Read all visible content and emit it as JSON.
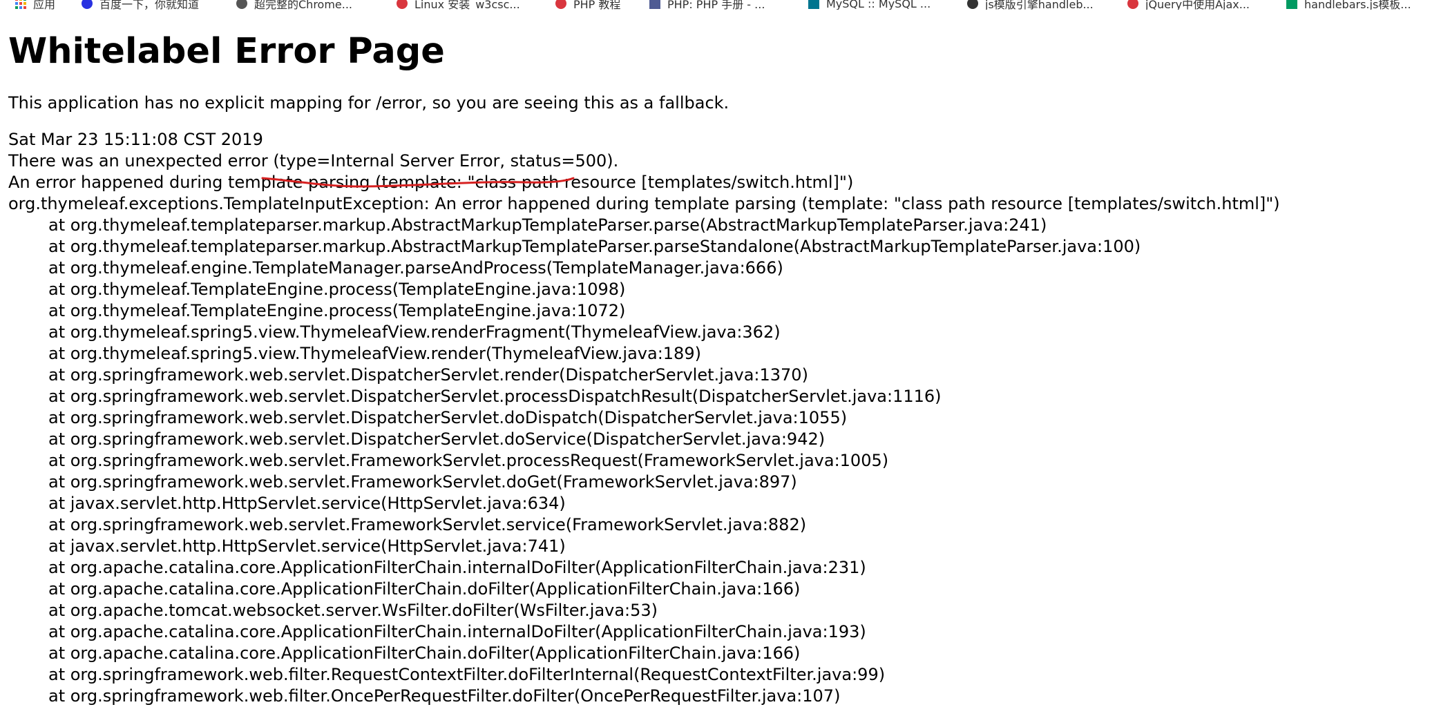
{
  "bookmarks": [
    {
      "label": "应用",
      "icon": "apps-grid-icon",
      "color": "#e8453c"
    },
    {
      "label": "百度一下，你就知道",
      "icon": "baidu-paw-icon",
      "color": "#2932e1"
    },
    {
      "label": "超完整的Chrome...",
      "icon": "leaf-icon",
      "color": "#555555"
    },
    {
      "label": "Linux 安装_w3csc...",
      "icon": "w3c-owl-icon",
      "color": "#d9363e"
    },
    {
      "label": "PHP 教程",
      "icon": "runoob-icon",
      "color": "#d9363e"
    },
    {
      "label": "PHP: PHP 手册 - ...",
      "icon": "php-icon",
      "color": "#4f5b93"
    },
    {
      "label": "MySQL :: MySQL ...",
      "icon": "mysql-icon",
      "color": "#00758f"
    },
    {
      "label": "js模版引擎handleb...",
      "icon": "github-icon",
      "color": "#333333"
    },
    {
      "label": "jQuery中使用Ajax...",
      "icon": "w3c-owl-icon",
      "color": "#d9363e"
    },
    {
      "label": "handlebars.js模板...",
      "icon": "segmentfault-icon",
      "color": "#009a61"
    }
  ],
  "page": {
    "title": "Whitelabel Error Page",
    "message": "This application has no explicit mapping for /error, so you are seeing this as a fallback.",
    "timestamp": "Sat Mar 23 15:11:08 CST 2019",
    "error_line": "There was an unexpected error (type=Internal Server Error, status=500).",
    "detail_line": "An error happened during template parsing (template: \"class path resource [templates/switch.html]\")",
    "exception_line": "org.thymeleaf.exceptions.TemplateInputException: An error happened during template parsing (template: \"class path resource [templates/switch.html]\")",
    "stack_trace": [
      "at org.thymeleaf.templateparser.markup.AbstractMarkupTemplateParser.parse(AbstractMarkupTemplateParser.java:241)",
      "at org.thymeleaf.templateparser.markup.AbstractMarkupTemplateParser.parseStandalone(AbstractMarkupTemplateParser.java:100)",
      "at org.thymeleaf.engine.TemplateManager.parseAndProcess(TemplateManager.java:666)",
      "at org.thymeleaf.TemplateEngine.process(TemplateEngine.java:1098)",
      "at org.thymeleaf.TemplateEngine.process(TemplateEngine.java:1072)",
      "at org.thymeleaf.spring5.view.ThymeleafView.renderFragment(ThymeleafView.java:362)",
      "at org.thymeleaf.spring5.view.ThymeleafView.render(ThymeleafView.java:189)",
      "at org.springframework.web.servlet.DispatcherServlet.render(DispatcherServlet.java:1370)",
      "at org.springframework.web.servlet.DispatcherServlet.processDispatchResult(DispatcherServlet.java:1116)",
      "at org.springframework.web.servlet.DispatcherServlet.doDispatch(DispatcherServlet.java:1055)",
      "at org.springframework.web.servlet.DispatcherServlet.doService(DispatcherServlet.java:942)",
      "at org.springframework.web.servlet.FrameworkServlet.processRequest(FrameworkServlet.java:1005)",
      "at org.springframework.web.servlet.FrameworkServlet.doGet(FrameworkServlet.java:897)",
      "at javax.servlet.http.HttpServlet.service(HttpServlet.java:634)",
      "at org.springframework.web.servlet.FrameworkServlet.service(FrameworkServlet.java:882)",
      "at javax.servlet.http.HttpServlet.service(HttpServlet.java:741)",
      "at org.apache.catalina.core.ApplicationFilterChain.internalDoFilter(ApplicationFilterChain.java:231)",
      "at org.apache.catalina.core.ApplicationFilterChain.doFilter(ApplicationFilterChain.java:166)",
      "at org.apache.tomcat.websocket.server.WsFilter.doFilter(WsFilter.java:53)",
      "at org.apache.catalina.core.ApplicationFilterChain.internalDoFilter(ApplicationFilterChain.java:193)",
      "at org.apache.catalina.core.ApplicationFilterChain.doFilter(ApplicationFilterChain.java:166)",
      "at org.springframework.web.filter.RequestContextFilter.doFilterInternal(RequestContextFilter.java:99)",
      "at org.springframework.web.filter.OncePerRequestFilter.doFilter(OncePerRequestFilter.java:107)"
    ]
  },
  "annotation": {
    "color": "#d62020"
  }
}
